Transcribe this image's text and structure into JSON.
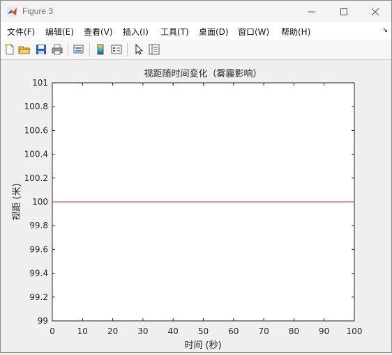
{
  "window": {
    "title": "Figure 3"
  },
  "menu": {
    "items": [
      "文件(F)",
      "编辑(E)",
      "查看(V)",
      "插入(I)",
      "工具(T)",
      "桌面(D)",
      "窗口(W)",
      "帮助(H)"
    ],
    "overflow": "↘"
  },
  "toolbar": {
    "icons": [
      "new-figure-icon",
      "open-file-icon",
      "save-icon",
      "print-icon",
      "link-plot-icon",
      "colorbar-icon",
      "legend-icon",
      "pointer-icon",
      "property-inspector-icon"
    ]
  },
  "chart_data": {
    "type": "line",
    "title": "视距随时间变化（雾霾影响）",
    "xlabel": "时间 (秒)",
    "ylabel": "视距 (米)",
    "xlim": [
      0,
      100
    ],
    "ylim": [
      99,
      101
    ],
    "xticks": [
      "0",
      "10",
      "20",
      "30",
      "40",
      "50",
      "60",
      "70",
      "80",
      "90",
      "100"
    ],
    "yticks": [
      "99",
      "99.2",
      "99.4",
      "99.6",
      "99.8",
      "100",
      "100.2",
      "100.4",
      "100.6",
      "100.8",
      "101"
    ],
    "grid": false,
    "series": [
      {
        "x": [
          0,
          100
        ],
        "y": [
          100,
          100
        ],
        "color": "#d62728"
      }
    ]
  }
}
